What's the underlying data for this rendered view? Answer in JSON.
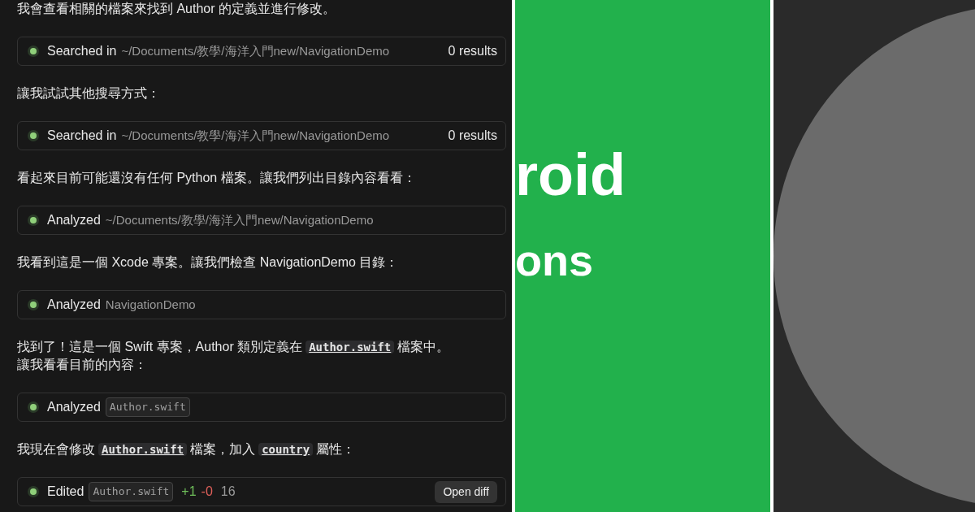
{
  "chat": {
    "items": [
      {
        "kind": "text",
        "parts": [
          {
            "kind": "text",
            "text": "我會查看相關的檔案來找到 Author 的定義並進行修改。"
          }
        ]
      },
      {
        "kind": "tool",
        "action": "Searched in",
        "target": "~/Documents/教學/海洋入門new/NavigationDemo",
        "chip": false,
        "result": "0 results"
      },
      {
        "kind": "text",
        "parts": [
          {
            "kind": "text",
            "text": "讓我試試其他搜尋方式："
          }
        ]
      },
      {
        "kind": "tool",
        "action": "Searched in",
        "target": "~/Documents/教學/海洋入門new/NavigationDemo",
        "chip": false,
        "result": "0 results"
      },
      {
        "kind": "text",
        "parts": [
          {
            "kind": "text",
            "text": "看起來目前可能還沒有任何 Python 檔案。讓我們列出目錄內容看看："
          }
        ]
      },
      {
        "kind": "tool",
        "action": "Analyzed",
        "target": "~/Documents/教學/海洋入門new/NavigationDemo",
        "chip": false
      },
      {
        "kind": "text",
        "parts": [
          {
            "kind": "text",
            "text": "我看到這是一個 Xcode 專案。讓我們檢查 NavigationDemo 目錄："
          }
        ]
      },
      {
        "kind": "tool",
        "action": "Analyzed",
        "target": "NavigationDemo",
        "chip": false
      },
      {
        "kind": "text",
        "parts": [
          {
            "kind": "text",
            "text": "找到了！這是一個 Swift 專案，Author 類別定義在"
          },
          {
            "kind": "code",
            "text": "Author.swift"
          },
          {
            "kind": "text",
            "text": "檔案中。"
          },
          {
            "kind": "text",
            "text": "讓我看看目前的內容："
          }
        ]
      },
      {
        "kind": "tool",
        "action": "Analyzed",
        "target": "Author.swift",
        "chip": true
      },
      {
        "kind": "text",
        "parts": [
          {
            "kind": "text",
            "text": "我現在會修改"
          },
          {
            "kind": "code",
            "text": "Author.swift"
          },
          {
            "kind": "text",
            "text": "檔案，加入"
          },
          {
            "kind": "code",
            "text": "country"
          },
          {
            "kind": "text",
            "text": "屬性："
          }
        ]
      },
      {
        "kind": "tool",
        "action": "Edited",
        "target": "Author.swift",
        "chip": true,
        "additions": "+1",
        "deletions": "-0",
        "lines": "16",
        "button": "Open diff"
      }
    ]
  },
  "slide": {
    "lines": [
      "roid",
      "ons"
    ]
  }
}
